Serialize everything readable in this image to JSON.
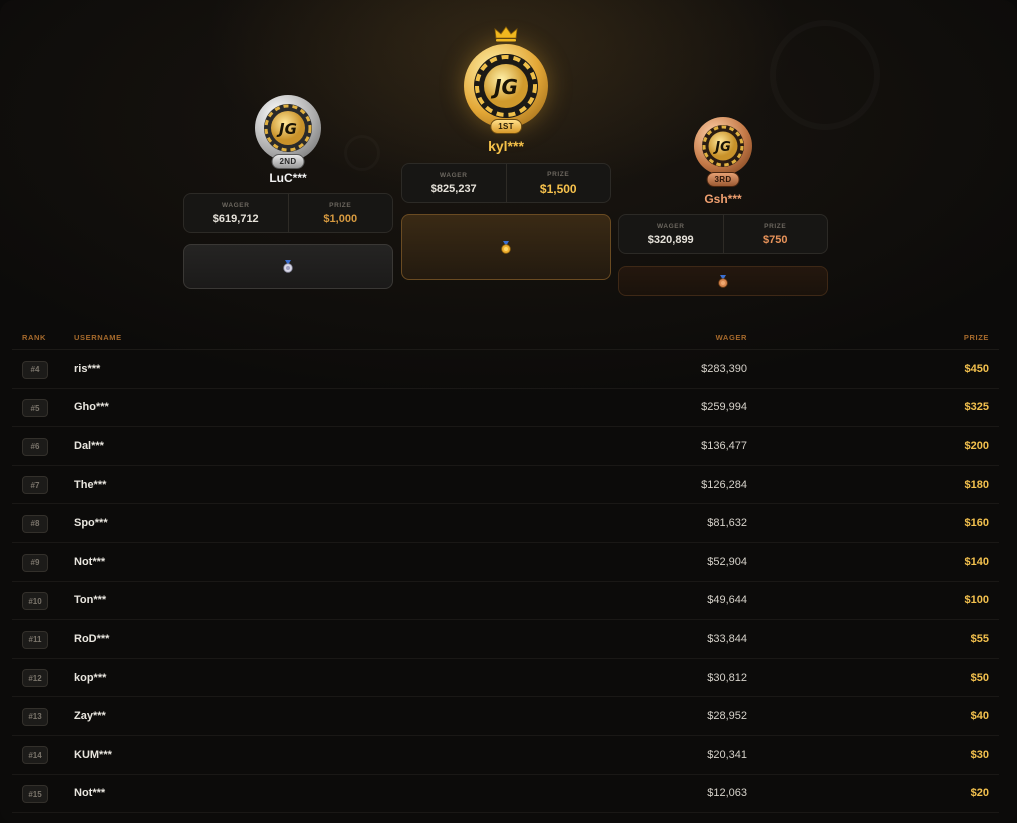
{
  "podium": {
    "first": {
      "place_label": "1ST",
      "name": "kyl***",
      "wager_label": "WAGER",
      "wager": "$825,237",
      "prize_label": "PRIZE",
      "prize": "$1,500",
      "logo_text": "JG"
    },
    "second": {
      "place_label": "2ND",
      "name": "LuC***",
      "wager_label": "WAGER",
      "wager": "$619,712",
      "prize_label": "PRIZE",
      "prize": "$1,000",
      "logo_text": "JG"
    },
    "third": {
      "place_label": "3RD",
      "name": "Gsh***",
      "wager_label": "WAGER",
      "wager": "$320,899",
      "prize_label": "PRIZE",
      "prize": "$750",
      "logo_text": "JG"
    }
  },
  "table": {
    "headers": {
      "rank": "RANK",
      "username": "USERNAME",
      "wager": "WAGER",
      "prize": "PRIZE"
    },
    "rows": [
      {
        "rank": "#4",
        "username": "ris***",
        "wager": "$283,390",
        "prize": "$450"
      },
      {
        "rank": "#5",
        "username": "Gho***",
        "wager": "$259,994",
        "prize": "$325"
      },
      {
        "rank": "#6",
        "username": "Dal***",
        "wager": "$136,477",
        "prize": "$200"
      },
      {
        "rank": "#7",
        "username": "The***",
        "wager": "$126,284",
        "prize": "$180"
      },
      {
        "rank": "#8",
        "username": "Spo***",
        "wager": "$81,632",
        "prize": "$160"
      },
      {
        "rank": "#9",
        "username": "Not***",
        "wager": "$52,904",
        "prize": "$140"
      },
      {
        "rank": "#10",
        "username": "Ton***",
        "wager": "$49,644",
        "prize": "$100"
      },
      {
        "rank": "#11",
        "username": "RoD***",
        "wager": "$33,844",
        "prize": "$55"
      },
      {
        "rank": "#12",
        "username": "kop***",
        "wager": "$30,812",
        "prize": "$50"
      },
      {
        "rank": "#13",
        "username": "Zay***",
        "wager": "$28,952",
        "prize": "$40"
      },
      {
        "rank": "#14",
        "username": "KUM***",
        "wager": "$20,341",
        "prize": "$30"
      },
      {
        "rank": "#15",
        "username": "Not***",
        "wager": "$12,063",
        "prize": "$20"
      }
    ]
  },
  "colors": {
    "gold": "#f5c24a",
    "silver": "#c8c8c8",
    "bronze": "#e0905a",
    "table_header": "#a66a2c"
  },
  "icons": {
    "crown": "crown-icon",
    "chip": "jg-casino-chip-logo",
    "medal": "medal-icon"
  }
}
